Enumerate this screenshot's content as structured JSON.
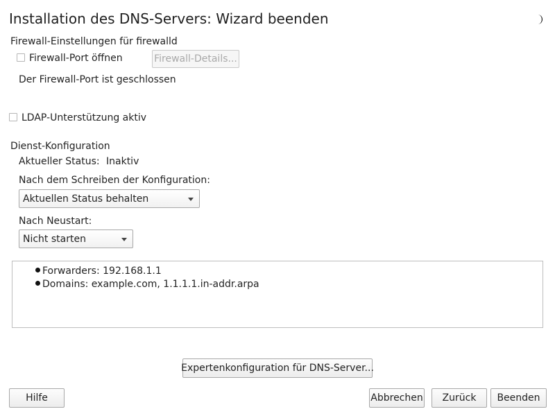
{
  "window": {
    "title": "Installation des DNS-Servers: Wizard beenden"
  },
  "firewall": {
    "section_label": "Firewall-Einstellungen für firewalld",
    "open_port_checkbox": {
      "label": "Firewall-Port öffnen",
      "checked": false
    },
    "details_button": "Firewall-Details...",
    "status_text": "Der Firewall-Port ist geschlossen"
  },
  "ldap": {
    "checkbox": {
      "label": "LDAP-Unterstützung aktiv",
      "checked": false
    }
  },
  "service": {
    "section_label": "Dienst-Konfiguration",
    "status_label": "Aktueller Status:",
    "status_value": "Inaktiv",
    "after_write_label": "Nach dem Schreiben der Konfiguration:",
    "after_write_value": "Aktuellen Status behalten",
    "after_reboot_label": "Nach Neustart:",
    "after_reboot_value": "Nicht starten"
  },
  "summary": {
    "items": [
      "Forwarders: 192.168.1.1",
      "Domains: example.com, 1.1.1.1.in-addr.arpa"
    ]
  },
  "buttons": {
    "expert": "Expertenkonfiguration für DNS-Server...",
    "help": "Hilfe",
    "abort": "Abbrechen",
    "back": "Zurück",
    "finish": "Beenden"
  },
  "icons": {
    "theme_toggle": "moon-icon"
  }
}
